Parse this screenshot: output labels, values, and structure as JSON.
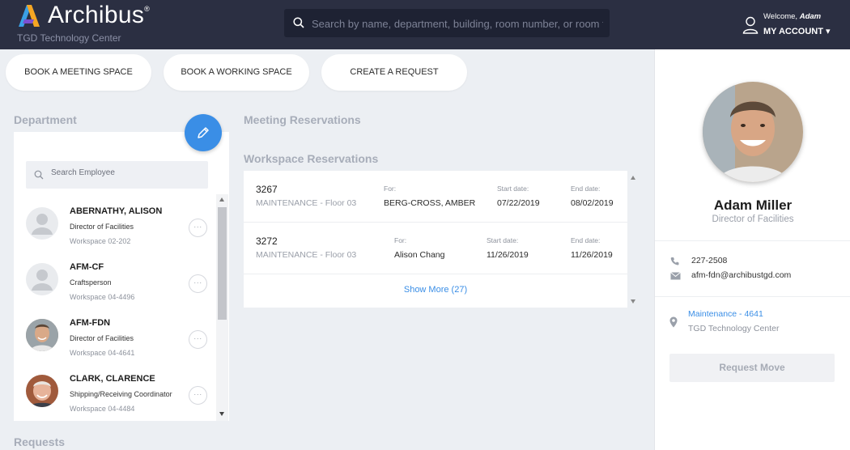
{
  "header": {
    "app_name": "Archibus",
    "registered_mark": "®",
    "subtitle": "TGD Technology Center",
    "search_placeholder": "Search by name, department, building, room number, or room type",
    "welcome_prefix": "Welcome, ",
    "welcome_user": "Adam",
    "account_label": "MY ACCOUNT",
    "account_caret": "▾"
  },
  "actions": [
    {
      "label": "BOOK A MEETING SPACE"
    },
    {
      "label": "BOOK A WORKING SPACE"
    },
    {
      "label": "CREATE A REQUEST"
    }
  ],
  "department": {
    "heading": "Department",
    "search_placeholder": "Search Employee",
    "employees": [
      {
        "name": "ABERNATHY, ALISON",
        "title": "Director of Facilities",
        "location": "Workspace 02-202",
        "avatar": "placeholder"
      },
      {
        "name": "AFM-CF",
        "title": "Craftsperson",
        "location": "Workspace 04-4496",
        "avatar": "placeholder"
      },
      {
        "name": "AFM-FDN",
        "title": "Director of Facilities",
        "location": "Workspace 04-4641",
        "avatar": "photo"
      },
      {
        "name": "CLARK, CLARENCE",
        "title": "Shipping/Receiving Coordinator",
        "location": "Workspace 04-4484",
        "avatar": "photo"
      }
    ],
    "more_glyph": "···"
  },
  "meeting": {
    "heading": "Meeting Reservations"
  },
  "workspace": {
    "heading": "Workspace Reservations",
    "rows": [
      {
        "id": "3267",
        "dept": "MAINTENANCE - Floor 03",
        "for_label": "For:",
        "for": "BERG-CROSS, AMBER",
        "start_label": "Start date:",
        "start": "07/22/2019",
        "end_label": "End date:",
        "end": "08/02/2019"
      },
      {
        "id": "3272",
        "dept": "MAINTENANCE - Floor 03",
        "for_label": "For:",
        "for": "Alison Chang",
        "start_label": "Start date:",
        "start": "11/26/2019",
        "end_label": "End date:",
        "end": "11/26/2019"
      }
    ],
    "show_more": "Show More (27)"
  },
  "requests": {
    "heading": "Requests"
  },
  "profile": {
    "name": "Adam Miller",
    "title": "Director of Facilities",
    "phone": "227-2508",
    "email": "afm-fdn@archibustgd.com",
    "location_link": "Maintenance - 4641",
    "location_sub": "TGD Technology Center",
    "request_move": "Request Move"
  },
  "colors": {
    "header_bg": "#2b2f42",
    "accent": "#3a8ee6",
    "page_bg": "#eceff3"
  }
}
